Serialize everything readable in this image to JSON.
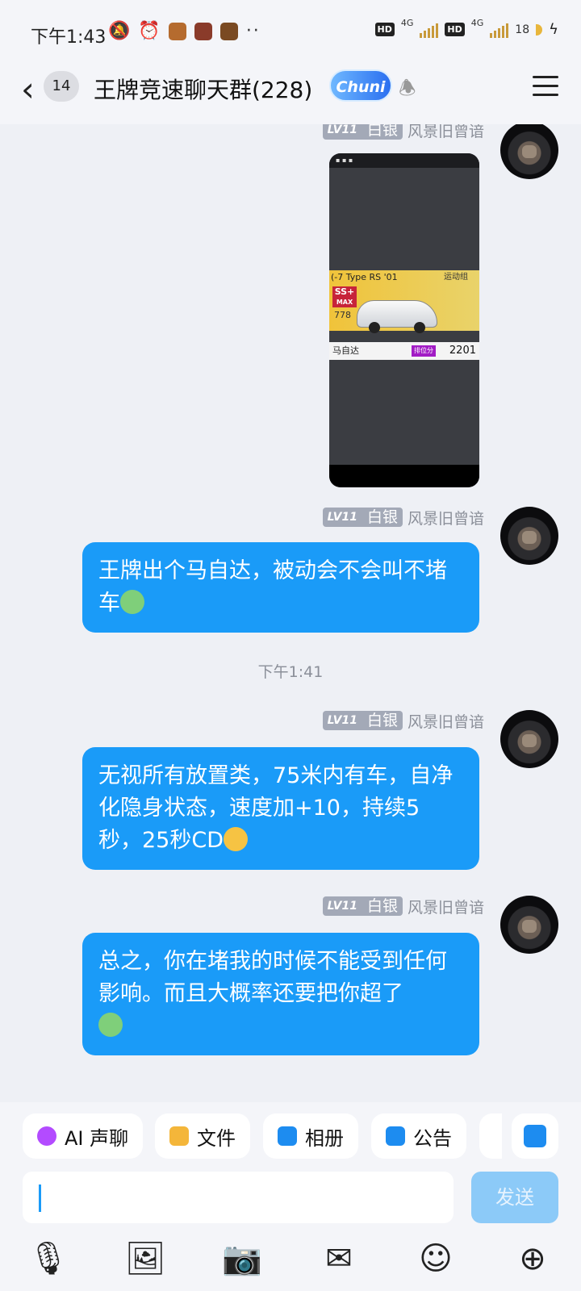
{
  "status_bar": {
    "time": "下午1:43",
    "icons": [
      "mute-icon",
      "alarm-icon",
      "app-icon",
      "app-icon",
      "app-icon",
      "more-dots"
    ],
    "network": [
      "HD",
      "4G",
      "HD",
      "4G"
    ],
    "battery": "18"
  },
  "header": {
    "back_badge": "14",
    "title": "王牌竞速聊天群(228)",
    "vip_badge": "Chuni"
  },
  "messages": [
    {
      "level": "LV11",
      "rank": "白银",
      "name": "风景旧曾谙",
      "type": "image",
      "image": {
        "car_title": "(-7 Type RS  '01",
        "group": "运动组",
        "grade": "SS+",
        "grade_sub": "MAX",
        "power": "778",
        "brand": "马自达",
        "rank_label": "排位分",
        "score": "2201"
      }
    },
    {
      "level": "LV11",
      "rank": "白银",
      "name": "风景旧曾谙",
      "type": "text",
      "text": "王牌出个马自达，被动会不会叫不堵车"
    },
    {
      "type": "timestamp",
      "text": "下午1:41"
    },
    {
      "level": "LV11",
      "rank": "白银",
      "name": "风景旧曾谙",
      "type": "text",
      "text": "无视所有放置类，75米内有车，自净化隐身状态，速度加+10，持续5秒，25秒CD"
    },
    {
      "level": "LV11",
      "rank": "白银",
      "name": "风景旧曾谙",
      "type": "text",
      "text": "总之，你在堵我的时候不能受到任何影响。而且大概率还要把你超了"
    }
  ],
  "quick_actions": [
    "AI 声聊",
    "文件",
    "相册",
    "公告"
  ],
  "input": {
    "value": "",
    "send_label": "发送"
  },
  "toolbar_icons": [
    "microphone-icon",
    "image-icon",
    "camera-icon",
    "red-packet-icon",
    "emoji-icon",
    "plus-icon"
  ],
  "colors": {
    "bubble": "#1a9bf8",
    "background": "#eef0f5",
    "send_disabled": "#8ccaf8",
    "rank_badge": "#a3a9b7"
  }
}
